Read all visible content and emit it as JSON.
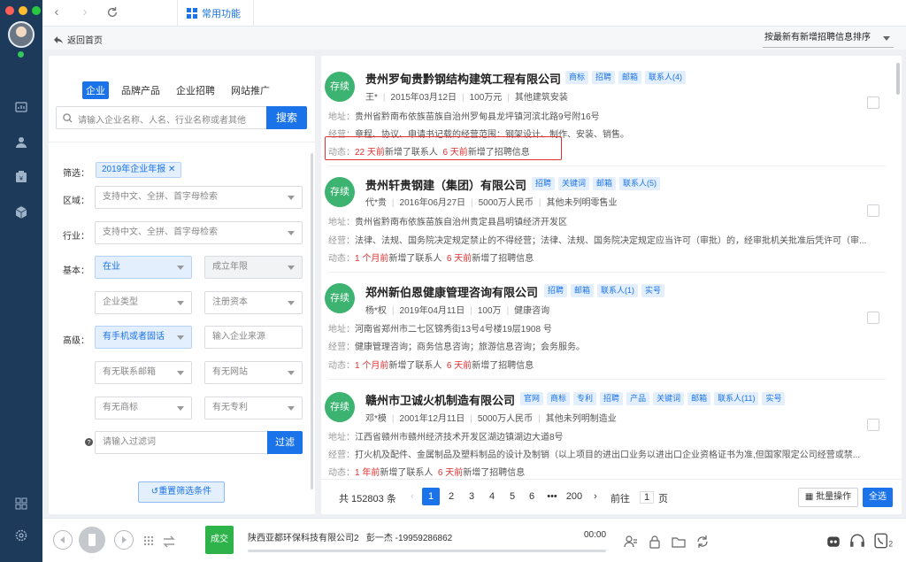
{
  "colors": {
    "accent": "#1a73e8",
    "sidebar": "#1d3a5a",
    "status_green": "#3cb371",
    "alert_red": "#e03131"
  },
  "topbar": {
    "tab_label": "常用功能",
    "back_label": "返回首页",
    "sort_label": "按最新有新增招聘信息排序"
  },
  "filters": {
    "tabs": [
      "企业",
      "品牌产品",
      "企业招聘",
      "网站推广"
    ],
    "search_placeholder": "请输入企业名称、人名、行业名称或者其他",
    "search_button": "搜索",
    "screen_label": "筛选：",
    "chip": "2019年企业年报",
    "region_label": "区域：",
    "region_placeholder": "支持中文、全拼、首字母检索",
    "industry_label": "行业：",
    "industry_placeholder": "支持中文、全拼、首字母检索",
    "basic_label": "基本：",
    "status_value": "在业",
    "founded_placeholder": "成立年限",
    "company_type_placeholder": "企业类型",
    "capital_placeholder": "注册资本",
    "advanced_label": "高级：",
    "contact_value": "有手机或者固话",
    "source_placeholder": "输入企业来源",
    "email_placeholder": "有无联系邮箱",
    "website_placeholder": "有无网站",
    "trademark_placeholder": "有无商标",
    "patent_placeholder": "有无专利",
    "filter_word_placeholder": "请输入过滤词",
    "filter_button": "过滤",
    "reset_button": "重置筛选条件"
  },
  "results": [
    {
      "status": "存续",
      "name": "贵州罗甸贵黔钢结构建筑工程有限公司",
      "tags": [
        "商标",
        "招聘",
        "邮箱",
        "联系人(4)"
      ],
      "person": "王*",
      "date": "2015年03月12日",
      "capital": "100万元",
      "industry": "其他建筑安装",
      "address_label": "地址：",
      "address": "贵州省黔南布依族苗族自治州罗甸县龙坪镇河滨北路9号附16号",
      "scope_label": "经营：",
      "scope": "章程、协议、申请书记载的经营范围：钢架设计、制作、安装、销售。",
      "dyn_label": "动态：",
      "dyn1_time": "22 天前",
      "dyn1_text": "新增了联系人",
      "dyn2_time": "6 天前",
      "dyn2_text": "新增了招聘信息"
    },
    {
      "status": "存续",
      "name": "贵州轩贵钢建（集团）有限公司",
      "tags": [
        "招聘",
        "关键词",
        "邮箱",
        "联系人(5)"
      ],
      "person": "代*贵",
      "date": "2016年06月27日",
      "capital": "5000万人民币",
      "industry": "其他未列明零售业",
      "address_label": "地址：",
      "address": "贵州省黔南布依族苗族自治州贵定县昌明镇经济开发区",
      "scope_label": "经营：",
      "scope": "法律、法规、国务院决定规定禁止的不得经营；法律、法规、国务院决定规定应当许可（审批）的，经审批机关批准后凭许可（审...",
      "dyn_label": "动态：",
      "dyn1_time": "1 个月前",
      "dyn1_text": "新增了联系人",
      "dyn2_time": "6 天前",
      "dyn2_text": "新增了招聘信息"
    },
    {
      "status": "存续",
      "name": "郑州新伯恩健康管理咨询有限公司",
      "tags": [
        "招聘",
        "邮箱",
        "联系人(1)",
        "实号"
      ],
      "person": "杨*权",
      "date": "2019年04月11日",
      "capital": "100万",
      "industry": "健康咨询",
      "address_label": "地址：",
      "address": "河南省郑州市二七区锦秀街13号4号楼19层1908 号",
      "scope_label": "经营：",
      "scope": "健康管理咨询；商务信息咨询；旅游信息咨询；会务服务。",
      "dyn_label": "动态：",
      "dyn1_time": "1 个月前",
      "dyn1_text": "新增了联系人",
      "dyn2_time": "6 天前",
      "dyn2_text": "新增了招聘信息"
    },
    {
      "status": "存续",
      "name": "赣州市卫诚火机制造有限公司",
      "tags": [
        "官网",
        "商标",
        "专利",
        "招聘",
        "产品",
        "关键词",
        "邮箱",
        "联系人(11)",
        "实号"
      ],
      "person": "邓*模",
      "date": "2001年12月11日",
      "capital": "5000万人民币",
      "industry": "其他未列明制造业",
      "address_label": "地址：",
      "address": "江西省赣州市赣州经济技术开发区湖边镇湖边大道8号",
      "scope_label": "经营：",
      "scope": "打火机及配件、金属制品及塑料制品的设计及制销（以上项目的进出口业务以进出口企业资格证书为准,但国家限定公司经营或禁...",
      "dyn_label": "动态：",
      "dyn1_time": "1 年前",
      "dyn1_text": "新增了联系人",
      "dyn2_time": "6 天前",
      "dyn2_text": "新增了招聘信息"
    }
  ],
  "pagination": {
    "total": "共 152803 条",
    "pages": [
      "1",
      "2",
      "3",
      "4",
      "5",
      "6",
      "•••",
      "200"
    ],
    "current": "1",
    "goto_label": "前往",
    "goto_value": "1",
    "page_suffix": "页",
    "batch_label": "批量操作",
    "select_all": "全选"
  },
  "call": {
    "deal_label": "成交",
    "company": "陕西亚都环保科技有限公司2",
    "contact": "彭一杰 -19959286862",
    "time": "00:00"
  }
}
